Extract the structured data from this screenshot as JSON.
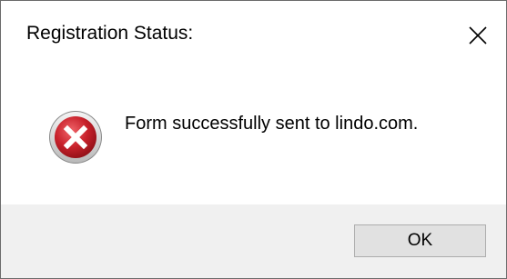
{
  "window": {
    "title": "Registration Status:",
    "close_icon": "close-icon"
  },
  "message": {
    "icon": "error-icon",
    "text": "Form successfully sent to lindo.com."
  },
  "buttons": {
    "ok_label": "OK"
  },
  "colors": {
    "icon_red": "#c8212b",
    "footer_bg": "#f0f0f0",
    "button_bg": "#e1e1e1",
    "button_border": "#adadad"
  }
}
